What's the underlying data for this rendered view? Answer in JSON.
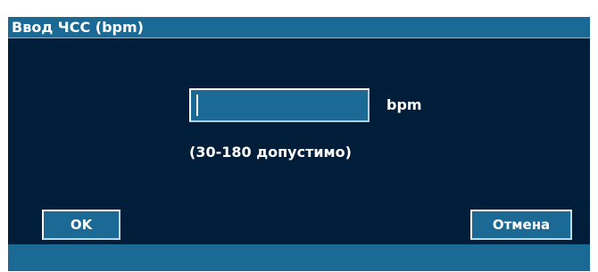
{
  "dialog": {
    "title": "Ввод ЧСС (bpm)",
    "input": {
      "value": "",
      "placeholder": ""
    },
    "unit_label": "bpm",
    "range_hint": "(30-180 допустимо)",
    "buttons": {
      "ok_label": "OK",
      "cancel_label": "Отмена"
    }
  },
  "colors": {
    "dialog_background": "#001e3a",
    "accent": "#1b6a95",
    "text": "#ffffff"
  }
}
